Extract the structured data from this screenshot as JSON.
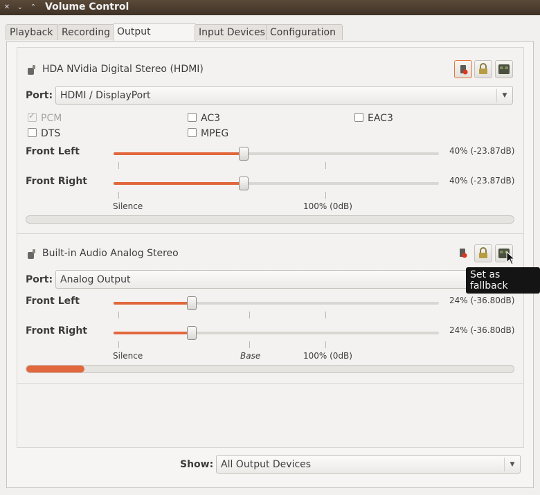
{
  "window": {
    "title": "Volume Control"
  },
  "tabs": [
    {
      "label": "Playback",
      "active": false
    },
    {
      "label": "Recording",
      "active": false
    },
    {
      "label": "Output Devices",
      "active": true
    },
    {
      "label": "Input Devices",
      "active": false
    },
    {
      "label": "Configuration",
      "active": false
    }
  ],
  "devices": [
    {
      "name": "HDA NVidia Digital Stereo (HDMI)",
      "port_label": "Port:",
      "port_value": "HDMI / DisplayPort",
      "formats": [
        {
          "label": "PCM",
          "checked": true,
          "disabled": true
        },
        {
          "label": "AC3",
          "checked": false,
          "disabled": false
        },
        {
          "label": "EAC3",
          "checked": false,
          "disabled": false
        },
        {
          "label": "DTS",
          "checked": false,
          "disabled": false
        },
        {
          "label": "MPEG",
          "checked": false,
          "disabled": false
        }
      ],
      "channels": [
        {
          "label": "Front Left",
          "value_text": "40% (-23.87dB)",
          "level": 0.4
        },
        {
          "label": "Front Right",
          "value_text": "40% (-23.87dB)",
          "level": 0.4
        }
      ],
      "scale": {
        "silence": "Silence",
        "hundred": "100% (0dB)"
      },
      "meter_level": 0.0,
      "mute_active": true
    },
    {
      "name": "Built-in Audio Analog Stereo",
      "port_label": "Port:",
      "port_value": "Analog Output",
      "channels": [
        {
          "label": "Front Left",
          "value_text": "24% (-36.80dB)",
          "level": 0.24
        },
        {
          "label": "Front Right",
          "value_text": "24% (-36.80dB)",
          "level": 0.24
        }
      ],
      "scale": {
        "silence": "Silence",
        "base": "Base",
        "hundred": "100% (0dB)"
      },
      "meter_level": 0.12,
      "mute_active": false
    }
  ],
  "tooltip": {
    "text": "Set as fallback"
  },
  "show": {
    "label": "Show:",
    "value": "All Output Devices"
  },
  "icons": {
    "mute": "speaker-mute-icon",
    "lock": "lock-icon",
    "fallback": "fallback-icon",
    "device": "speaker-device-icon"
  },
  "colors": {
    "accent": "#e2673d",
    "titlebar": "#4a3b2d"
  }
}
